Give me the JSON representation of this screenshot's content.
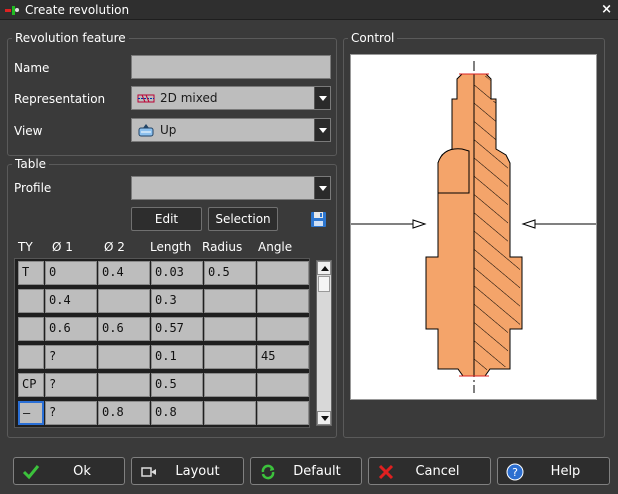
{
  "window": {
    "title": "Create revolution",
    "close": "×"
  },
  "feature": {
    "legend": "Revolution feature",
    "name_label": "Name",
    "name_value": "",
    "representation_label": "Representation",
    "representation_value": "2D mixed",
    "view_label": "View",
    "view_value": "Up"
  },
  "table": {
    "legend": "Table",
    "profile_label": "Profile",
    "profile_value": "",
    "edit_label": "Edit",
    "selection_label": "Selection",
    "columns": [
      "TY",
      "Ø 1",
      "Ø 2",
      "Length",
      "Radius",
      "Angle"
    ],
    "rows": [
      [
        "T",
        "0",
        "0.4",
        "0.03",
        "0.5",
        ""
      ],
      [
        "",
        "0.4",
        "",
        "0.3",
        "",
        ""
      ],
      [
        "",
        "0.6",
        "0.6",
        "0.57",
        "",
        ""
      ],
      [
        "",
        "?",
        "",
        "0.1",
        "",
        "45"
      ],
      [
        "CP",
        "?",
        "",
        "0.5",
        "",
        ""
      ],
      [
        "–",
        "?",
        "0.8",
        "0.8",
        "",
        ""
      ]
    ]
  },
  "control": {
    "legend": "Control"
  },
  "buttons": {
    "ok": "Ok",
    "layout": "Layout",
    "default": "Default",
    "cancel": "Cancel",
    "help": "Help"
  },
  "colors": {
    "part_fill": "#f4a46a",
    "part_stroke": "#000000",
    "active_cell": "#2a6fd6"
  }
}
